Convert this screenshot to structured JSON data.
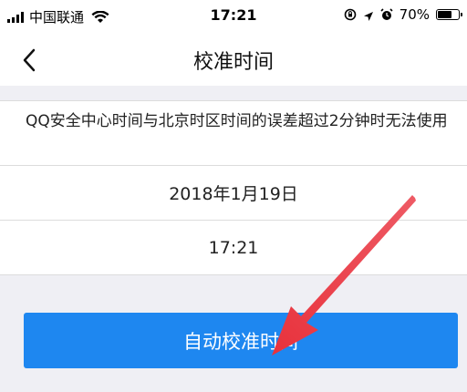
{
  "status_bar": {
    "carrier": "中国联通",
    "time": "17:21",
    "battery": "70%",
    "battery_level": 0.7
  },
  "nav": {
    "title": "校准时间"
  },
  "notice": {
    "text": "QQ安全中心时间与北京时区时间的误差超过2分钟时无法使用"
  },
  "date_row": {
    "value": "2018年1月19日"
  },
  "time_row": {
    "value": "17:21"
  },
  "actions": {
    "auto_calibrate_label": "自动校准时间"
  },
  "colors": {
    "primary": "#1e87f0",
    "annotation_arrow": "#e8323c"
  }
}
